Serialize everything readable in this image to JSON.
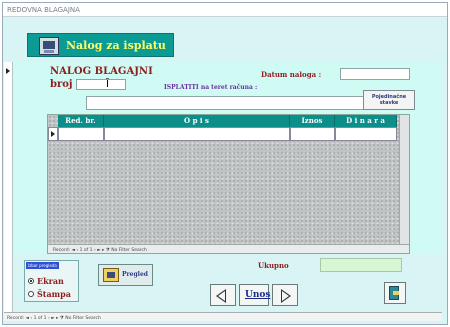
{
  "window": {
    "title": "REDOVNA BLAGAJNA"
  },
  "header": {
    "title": "Nalog za isplatu",
    "icon": "form-icon"
  },
  "form": {
    "title_line1": "NALOG BLAGAJNI",
    "title_line2": "broj :",
    "broj_value": "",
    "datum_label": "Datum naloga :",
    "datum_value": "",
    "isplatiti_label": "ISPLATITI na teret računa :",
    "racun_value": "",
    "pojedinacne_label": "Pojedinačne stavke"
  },
  "subform": {
    "columns": [
      "Red. br.",
      "O p i s",
      "Iznos",
      "D i n a r a"
    ],
    "nav_text": "Record: ◄ ‹ 1 of 1 › ► ▸   ⧩ No Filter   Search"
  },
  "footer": {
    "group_label": "Izbor pregleda",
    "option_ekran": "Ekran",
    "option_stampa": "Štampa",
    "selected_option": "Ekran",
    "pregled_label": "Pregled",
    "ukupno_label": "Ukupno",
    "ukupno_value": "",
    "unos_label": "Unos"
  },
  "bottom_nav": {
    "text": "Record: ◄ ‹ 1 of 1 › ► ▸   ⧩ No Filter   Search"
  },
  "colors": {
    "form_bg": "#d0fbf4",
    "header_bg": "#0c9a94",
    "header_text": "#ffff66",
    "label_red": "#8e1d1d",
    "label_purple": "#6a2fa0",
    "column_header": "#0c8e8a",
    "ukupno_bg": "#d7f7d2"
  }
}
